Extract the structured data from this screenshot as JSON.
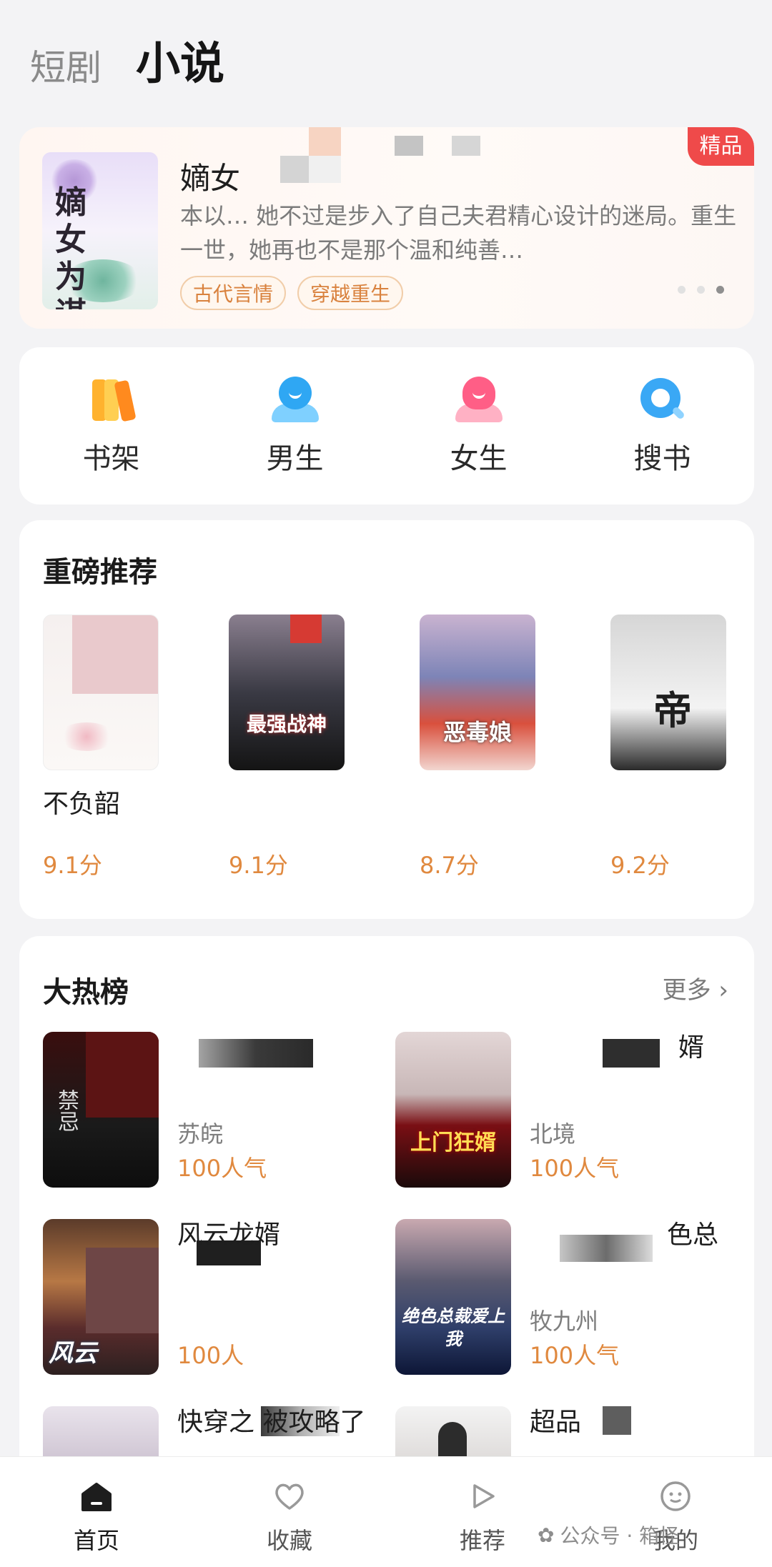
{
  "header": {
    "tabs": [
      {
        "label": "短剧"
      },
      {
        "label": "小说"
      }
    ]
  },
  "featured": {
    "badge": "精品",
    "title": "嫡女",
    "desc": "本以… 她不过是步入了自己夫君精心设计的迷局。重生一世，她再也不是那个温和纯善…",
    "tags": [
      "古代言情",
      "穿越重生"
    ],
    "cover_title": "嫡女为谋",
    "cover_sub": "嫡女为谋",
    "colors": {
      "badge": "#ef4a4a",
      "tag_text": "#d9823e"
    }
  },
  "quicknav": {
    "items": [
      {
        "label": "书架",
        "icon": "bookshelf-icon"
      },
      {
        "label": "男生",
        "icon": "male-icon"
      },
      {
        "label": "女生",
        "icon": "female-icon"
      },
      {
        "label": "搜书",
        "icon": "search-icon"
      }
    ]
  },
  "recommend": {
    "title": "重磅推荐",
    "items": [
      {
        "name": "不负韶",
        "score": "9.1分",
        "cover_text": ""
      },
      {
        "name": "",
        "score": "9.1分",
        "cover_text": "最强战神"
      },
      {
        "name": "",
        "score": "8.7分",
        "cover_text": "恶毒娘"
      },
      {
        "name": "",
        "score": "9.2分",
        "cover_text": "帝"
      }
    ]
  },
  "hot": {
    "title": "大热榜",
    "more": "更多",
    "items": [
      {
        "title": "",
        "author": "苏皖",
        "pop": "100人气",
        "cover_text": "禁忌"
      },
      {
        "title": "婿",
        "author": "北境",
        "pop": "100人气",
        "cover_text": "上门狂婿"
      },
      {
        "title": "风云龙婿",
        "author": "",
        "pop": "100人",
        "cover_text": "风云"
      },
      {
        "title": "色总",
        "author": "牧九州",
        "pop": "100人气",
        "cover_text": "绝色总裁爱上我"
      },
      {
        "title": "快穿之 被攻略了",
        "author": "",
        "pop": "",
        "cover_text": ""
      },
      {
        "title": "超品",
        "author": "",
        "pop": "",
        "cover_text": ""
      }
    ]
  },
  "bottom_nav": {
    "items": [
      {
        "label": "首页",
        "icon": "home-icon"
      },
      {
        "label": "收藏",
        "icon": "heart-icon"
      },
      {
        "label": "推荐",
        "icon": "play-icon"
      },
      {
        "label": "我的",
        "icon": "smiley-icon"
      }
    ]
  },
  "watermark": "公众号 · 箱怪"
}
